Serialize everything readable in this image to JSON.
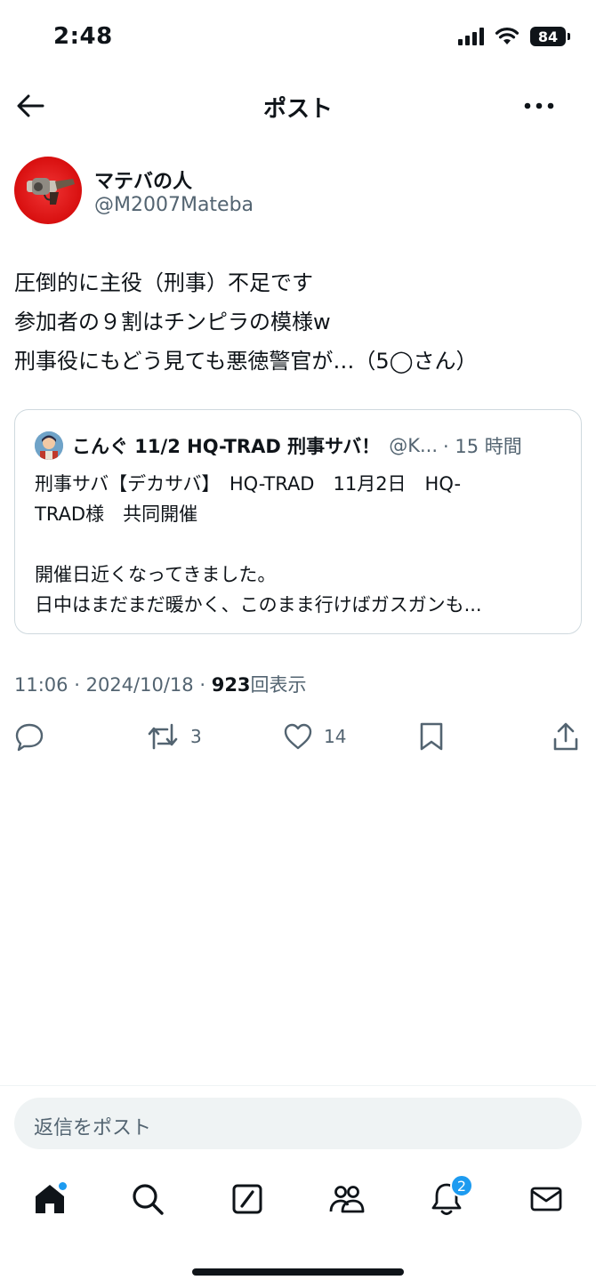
{
  "status_bar": {
    "time": "2:48",
    "battery": "84"
  },
  "header": {
    "title": "ポスト",
    "back_icon": "arrow-left-icon",
    "more_icon": "ellipsis-icon"
  },
  "author": {
    "display_name": "マテバの人",
    "handle": "@M2007Mateba"
  },
  "post": {
    "lines": [
      "圧倒的に主役（刑事）不足です",
      "参加者の９割はチンピラの模様w",
      "刑事役にもどう見ても悪徳警官が…（5◯さん）"
    ]
  },
  "quote": {
    "author_name": "こんぐ 11/2 HQ-TRAD 刑事サバ！",
    "handle": "@K...",
    "time": "· 15 時間",
    "lines": [
      "刑事サバ【デカサバ】　HQ-TRAD　11月2日　HQ-",
      "TRAD様　共同開催",
      "",
      "開催日近くなってきました。",
      "日中はまだまだ暖かく、このまま行けばガスガンも..."
    ]
  },
  "meta": {
    "time": "11:06",
    "date": "2024/10/18",
    "separator": "·",
    "views": "923",
    "views_label": "回表示"
  },
  "actions": {
    "retweets": "3",
    "likes": "14"
  },
  "reply": {
    "placeholder": "返信をポスト"
  },
  "tabbar": {
    "notifications_badge": "2"
  },
  "colors": {
    "text": "#0f1419",
    "secondary": "#536471",
    "accent": "#1d9bf0",
    "border": "#cfd9de"
  }
}
